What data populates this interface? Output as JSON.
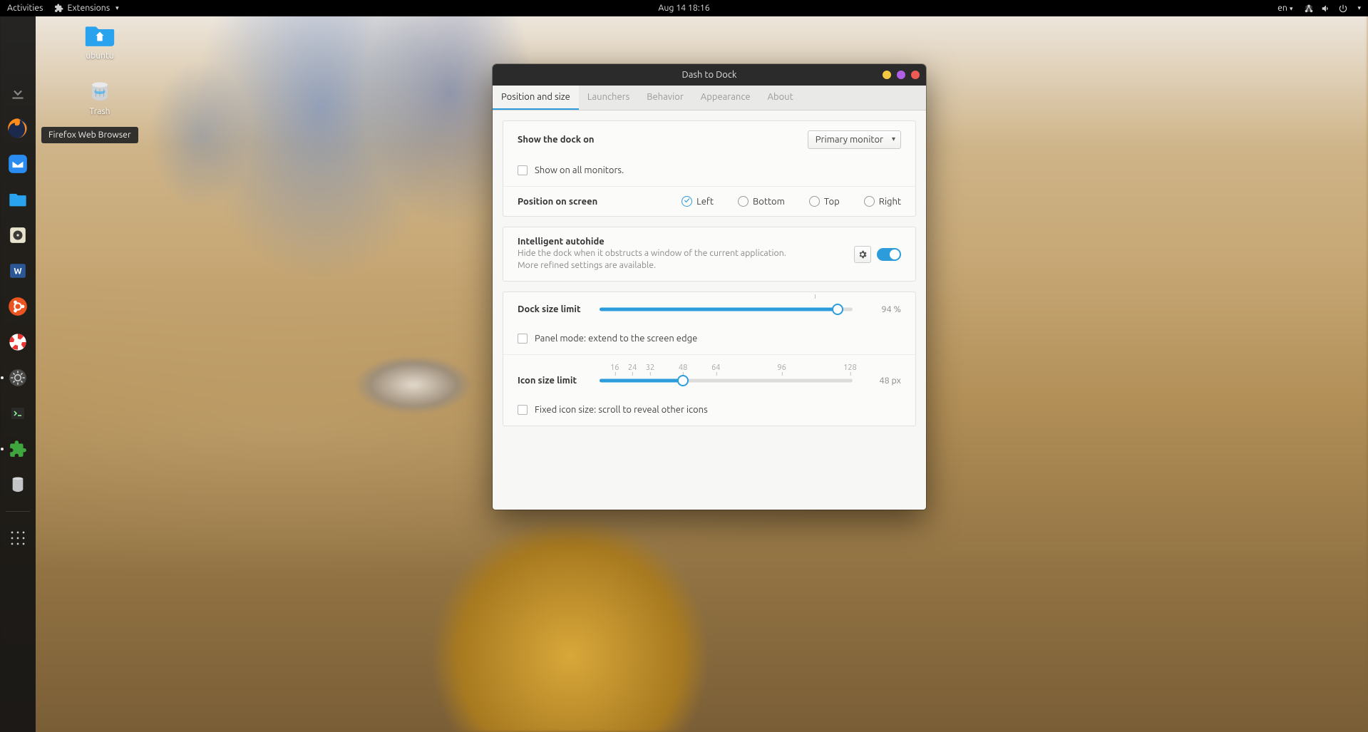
{
  "topbar": {
    "activities": "Activities",
    "extensions": "Extensions",
    "datetime": "Aug 14  18:16",
    "lang": "en"
  },
  "desktop": {
    "ubuntu": "ubuntu",
    "trash": "Trash"
  },
  "tooltip": {
    "firefox": "Firefox Web Browser"
  },
  "window": {
    "title": "Dash to Dock",
    "tabs": {
      "position": "Position and size",
      "launchers": "Launchers",
      "behavior": "Behavior",
      "appearance": "Appearance",
      "about": "About"
    },
    "show_dock_on": "Show the dock on",
    "primary_monitor": "Primary monitor",
    "show_all_monitors": "Show on all monitors.",
    "position_on_screen": "Position on screen",
    "pos": {
      "left": "Left",
      "bottom": "Bottom",
      "top": "Top",
      "right": "Right"
    },
    "autohide_title": "Intelligent autohide",
    "autohide_desc": "Hide the dock when it obstructs a window of the current application. More refined settings are available.",
    "dock_size_limit": "Dock size limit",
    "dock_size_value": "94 %",
    "dock_size_pct": 94,
    "panel_mode": "Panel mode: extend to the screen edge",
    "icon_size_limit": "Icon size limit",
    "icon_size_value": "48 px",
    "icon_marks": {
      "m16": "16",
      "m24": "24",
      "m32": "32",
      "m48": "48",
      "m64": "64",
      "m96": "96",
      "m128": "128"
    },
    "icon_size_pct": 33,
    "fixed_icon_size": "Fixed icon size: scroll to reveal other icons"
  }
}
